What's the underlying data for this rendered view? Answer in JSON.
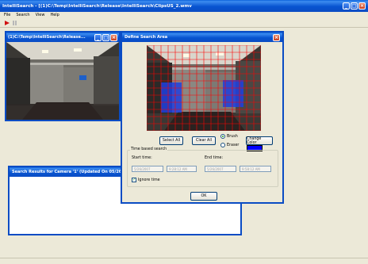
{
  "app": {
    "title": "IntelliSearch - [(1)C:\\Temp\\IntelliSearch\\Release\\IntelliSearch\\ClipsUS_2.wmv"
  },
  "menu": [
    {
      "label": "File"
    },
    {
      "label": "Search"
    },
    {
      "label": "View"
    },
    {
      "label": "Help"
    }
  ],
  "toolbar": {
    "play_icon": "play-icon",
    "pause_icon": "pause-icon"
  },
  "camera_window": {
    "title": "(1)C:\\Temp\\IntelliSearch\\Release..."
  },
  "results_window": {
    "title": "Search Results for Camera '1' (Updated On 05/26/2007"
  },
  "dialog": {
    "title": "Define Search Area",
    "select_all": "Select All",
    "clear_all": "Clear All",
    "brush_label": "Brush",
    "eraser_label": "Eraser",
    "change_color": "Change Color",
    "brush_color": "#0000ff",
    "time_group": "Time based search",
    "start_time": "Start time:",
    "end_time": "End time:",
    "start_date_value": "5/26/2007",
    "start_clock_value": "9:28:12 AM",
    "end_date_value": "5/26/2007",
    "end_clock_value": "9:58:12 AM",
    "ignore_time": "Ignore time",
    "ok": "OK"
  },
  "colors": {
    "titlebar": "#0a5fd8",
    "grid": "#ff0000",
    "selection": "#0000ff"
  }
}
